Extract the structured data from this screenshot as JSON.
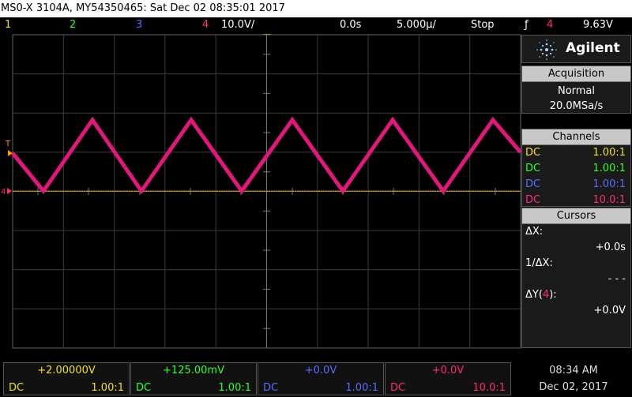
{
  "title": "MS0-X 3104A, MY54350465: Sat Dec 02 08:35:01 2017",
  "status": {
    "ch1": "1",
    "ch2": "2",
    "ch3": "3",
    "ch4": "4",
    "scale": "10.0V/",
    "time_offset": "0.0s",
    "time_scale": "5.000µ/",
    "run_state": "Stop",
    "trigger_symbol": "ƒ",
    "trigger_source": "4",
    "trigger_level": "9.63V"
  },
  "colors": {
    "ch1": "#f0e020",
    "ch2": "#30ff30",
    "ch3": "#5a6cff",
    "ch4": "#ff2a7a",
    "trace": "#e0187a",
    "marker": "#ff9a00"
  },
  "side": {
    "brand": "Agilent",
    "acquisition": {
      "header": "Acquisition",
      "mode": "Normal",
      "rate": "20.0MSa/s"
    },
    "channels": {
      "header": "Channels",
      "items": [
        {
          "coupling": "DC",
          "probe": "1.00:1"
        },
        {
          "coupling": "DC",
          "probe": "1.00:1"
        },
        {
          "coupling": "DC",
          "probe": "1.00:1"
        },
        {
          "coupling": "DC",
          "probe": "10.0:1"
        }
      ]
    },
    "cursors": {
      "header": "Cursors",
      "dx_label": "ΔX:",
      "dx_value": "+0.0s",
      "inv_dx_label": "1/ΔX:",
      "inv_dx_value": "- - -",
      "dy_label_prefix": "ΔY(",
      "dy_label_channel": "4",
      "dy_label_suffix": "):",
      "dy_value": "+0.0V"
    }
  },
  "bottom": {
    "channels": [
      {
        "offset": "+2.00000V",
        "coupling": "DC",
        "probe": "1.00:1"
      },
      {
        "offset": "+125.00mV",
        "coupling": "DC",
        "probe": "1.00:1"
      },
      {
        "offset": "+0.0V",
        "coupling": "DC",
        "probe": "1.00:1"
      },
      {
        "offset": "+0.0V",
        "coupling": "DC",
        "probe": "10.0:1"
      }
    ],
    "time": "08:34 AM",
    "date": "Dec 02, 2017"
  },
  "markers": {
    "trigger": "T",
    "ground": "4"
  }
}
